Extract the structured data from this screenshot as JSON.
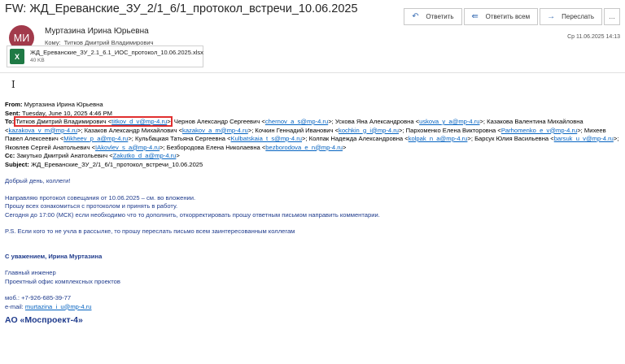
{
  "window": {
    "title": "FW: ЖД_Ереванские_ЗУ_2/1_6/1_протокол_встречи_10.06.2025"
  },
  "header": {
    "avatar_initials": "МИ",
    "sender_name": "Муртазина Ирина Юрьевна",
    "to_label": "Кому:",
    "to_value": "Титков Дмитрий Владимирович",
    "datetime": "Ср 11.06.2025 14:13"
  },
  "actions": {
    "reply": "Ответить",
    "reply_all": "Ответить всем",
    "forward": "Переслать",
    "more": "…"
  },
  "attachment": {
    "name": "ЖД_Ереванские_ЗУ_2.1_6.1_ИОС_протокол_10.06.2025.xlsx",
    "size": "40 KB"
  },
  "fwd": {
    "from_label": "From:",
    "from_value": "Муртазина Ирина Юрьевна",
    "sent_label": "Sent:",
    "sent_value": "Tuesday, June 10, 2025 4:46 PM",
    "to_label": "To:",
    "to_first_name": "Титков Дмитрий Владимирович",
    "to_first_email": "titkov_d_v@mp-4.ru",
    "recipients": [
      {
        "name": "Чернов Александр Сергеевич",
        "email": "chernov_a_s@mp-4.ru"
      },
      {
        "name": "Ускова Яна Александровна",
        "email": "uskova_y_a@mp-4.ru"
      },
      {
        "name": "Казакова Валентина Михайловна",
        "email": "kazakova_v_m@mp-4.ru"
      },
      {
        "name": "Казаков Александр Михайлович",
        "email": "kazakov_a_m@mp-4.ru"
      },
      {
        "name": "Кочкин Геннадий Иванович",
        "email": "kochkin_g_i@mp-4.ru"
      },
      {
        "name": "Пархоменко Елена Викторовна",
        "email": "Parhomenko_e_v@mp-4.ru"
      },
      {
        "name": "Михеев Павел Алексеевич",
        "email": "Mikheev_p_a@mp-4.ru"
      },
      {
        "name": "Кульбацкая Татьяна Сергеевна",
        "email": "Kulbatskaia_t_s@mp-4.ru"
      },
      {
        "name": "Колпак Надежда Александровна",
        "email": "kolpak_n_a@mp-4.ru"
      },
      {
        "name": "Барсук Юлия Васильевна",
        "email": "barsuk_u_v@mp-4.ru"
      },
      {
        "name": "Яковлев Сергей Анатольевич",
        "email": "IAkovlev_s_a@mp-4.ru"
      },
      {
        "name": "Безбородова Елена Николаевна",
        "email": "bezborodova_e_n@mp-4.ru"
      }
    ],
    "cc_label": "Cc:",
    "cc_name": "Закутько Дмитрий Анатольевич",
    "cc_email": "Zakutko_d_a@mp-4.ru",
    "subject_label": "Subject:",
    "subject_value": "ЖД_Ереванские_ЗУ_2/1_6/1_протокол_встречи_10.06.2025"
  },
  "message": {
    "greeting": "Добрый день, коллеги!",
    "line1": "Направляю протокол совещания от 10.06.2025 – см. во вложении.",
    "line2": "Прошу всех ознакомиться с протоколом и принять в работу.",
    "line3": "Сегодня до 17:00 (МСК) если необходимо что то дополнить, откорректировать прошу ответным письмом направить комментарии.",
    "ps": "P.S. Если кого то не учла в рассылке, то прошу переслать письмо всем заинтересованным коллегам"
  },
  "signature": {
    "regards": "С уважением, Ирина Муртазина",
    "position": "Главный инженер",
    "department": "Проектный офис комплексных проектов",
    "mobile": "моб.: +7-926-685-39-77",
    "email_label": "e-mail:",
    "email": "murtazina_i_u@mp-4.ru",
    "company": "АО «Моспроект-4»"
  }
}
